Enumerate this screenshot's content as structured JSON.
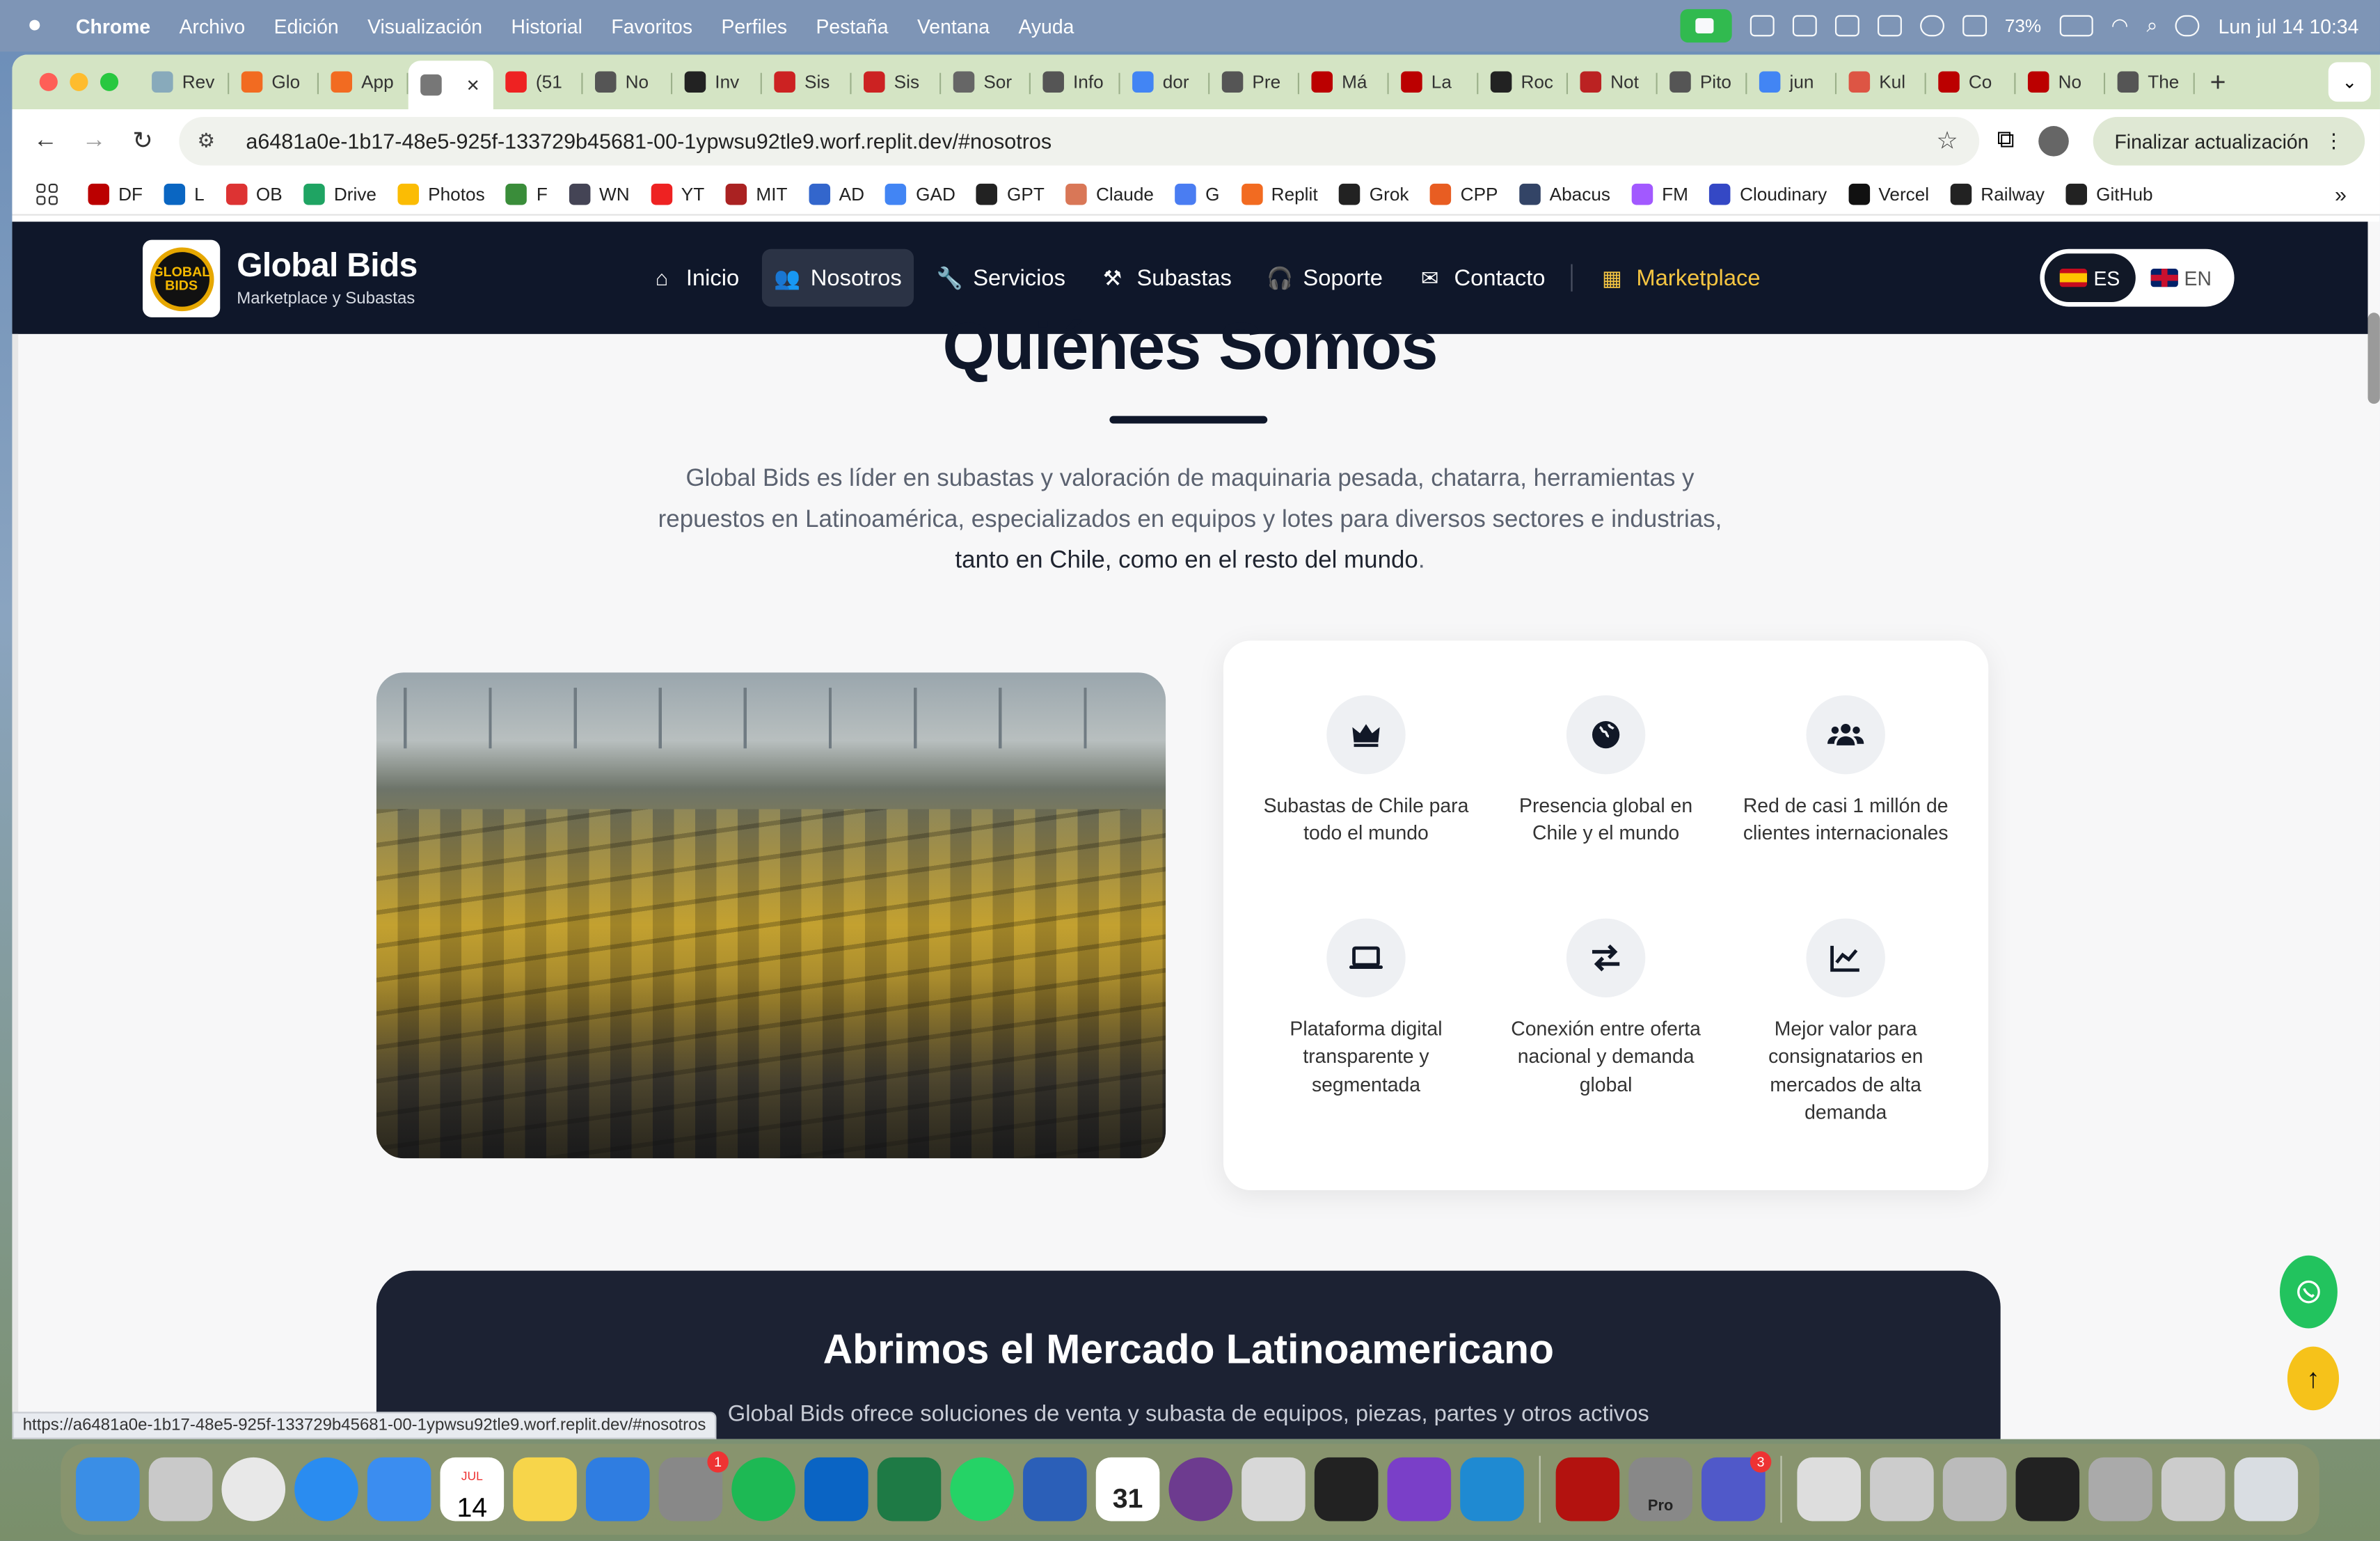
{
  "menubar": {
    "items": [
      "Chrome",
      "Archivo",
      "Edición",
      "Visualización",
      "Historial",
      "Favoritos",
      "Perfiles",
      "Pestaña",
      "Ventana",
      "Ayuda"
    ],
    "battery": "73%",
    "datetime": "Lun jul 14  10:34"
  },
  "browser": {
    "tabs": [
      {
        "label": "Rev",
        "color": "#8ab"
      },
      {
        "label": "Glo",
        "color": "#f26b21"
      },
      {
        "label": "App",
        "color": "#f26b21"
      },
      {
        "label": "",
        "color": "#777",
        "active": true
      },
      {
        "label": "(51",
        "color": "#e22"
      },
      {
        "label": "No",
        "color": "#555"
      },
      {
        "label": "Inv",
        "color": "#222"
      },
      {
        "label": "Sis",
        "color": "#c22"
      },
      {
        "label": "Sis",
        "color": "#c22"
      },
      {
        "label": "Sor",
        "color": "#666"
      },
      {
        "label": "Info",
        "color": "#555"
      },
      {
        "label": "dor",
        "color": "#4285f4"
      },
      {
        "label": "Pre",
        "color": "#555"
      },
      {
        "label": "Má",
        "color": "#b00"
      },
      {
        "label": "La",
        "color": "#b00"
      },
      {
        "label": "Roc",
        "color": "#222"
      },
      {
        "label": "Not",
        "color": "#b22"
      },
      {
        "label": "Pito",
        "color": "#555"
      },
      {
        "label": "jun",
        "color": "#4285f4"
      },
      {
        "label": "Kul",
        "color": "#d54"
      },
      {
        "label": "Co",
        "color": "#b00"
      },
      {
        "label": "No",
        "color": "#b00"
      },
      {
        "label": "The",
        "color": "#555"
      }
    ],
    "url": "a6481a0e-1b17-48e5-925f-133729b45681-00-1ypwsu92tle9.worf.replit.dev/#nosotros",
    "update_label": "Finalizar actualización",
    "bookmarks": [
      {
        "label": "DF",
        "color": "#b00"
      },
      {
        "label": "L",
        "color": "#0a66c2"
      },
      {
        "label": "OB",
        "color": "#d33"
      },
      {
        "label": "Drive",
        "color": "#1fa463"
      },
      {
        "label": "Photos",
        "color": "#fbbc04"
      },
      {
        "label": "F",
        "color": "#3a8d3a"
      },
      {
        "label": "WN",
        "color": "#445"
      },
      {
        "label": "YT",
        "color": "#e22"
      },
      {
        "label": "MIT",
        "color": "#a22"
      },
      {
        "label": "AD",
        "color": "#3366cc"
      },
      {
        "label": "GAD",
        "color": "#4285f4"
      },
      {
        "label": "GPT",
        "color": "#222"
      },
      {
        "label": "Claude",
        "color": "#d97757"
      },
      {
        "label": "G",
        "color": "#4a7df2"
      },
      {
        "label": "Replit",
        "color": "#f26b21"
      },
      {
        "label": "Grok",
        "color": "#222"
      },
      {
        "label": "CPP",
        "color": "#e85d22"
      },
      {
        "label": "Abacus",
        "color": "#346"
      },
      {
        "label": "FM",
        "color": "#a259ff"
      },
      {
        "label": "Cloudinary",
        "color": "#3448c5"
      },
      {
        "label": "Vercel",
        "color": "#111"
      },
      {
        "label": "Railway",
        "color": "#222"
      },
      {
        "label": "GitHub",
        "color": "#222"
      }
    ],
    "status_url": "https://a6481a0e-1b17-48e5-925f-133729b45681-00-1ypwsu92tle9.worf.replit.dev/#nosotros"
  },
  "site": {
    "brand_title": "Global Bids",
    "brand_subtitle": "Marketplace y Subastas",
    "logo_text": "GLOBAL BIDS",
    "nav": [
      {
        "label": "Inicio",
        "icon": "home-icon",
        "glyph": "⌂"
      },
      {
        "label": "Nosotros",
        "icon": "users-icon",
        "glyph": "👥",
        "active": true
      },
      {
        "label": "Servicios",
        "icon": "wrench-icon",
        "glyph": "🔧"
      },
      {
        "label": "Subastas",
        "icon": "gavel-icon",
        "glyph": "⚒"
      },
      {
        "label": "Soporte",
        "icon": "headset-icon",
        "glyph": "🎧"
      },
      {
        "label": "Contacto",
        "icon": "envelope-icon",
        "glyph": "✉"
      },
      {
        "label": "Marketplace",
        "icon": "grid-icon",
        "glyph": "▦",
        "accent": true
      }
    ],
    "lang": {
      "es": "ES",
      "en": "EN"
    },
    "colors": {
      "navy": "#0f172a",
      "accent": "#f5c542",
      "whatsapp": "#22c35e",
      "scrolltop": "#f6c21a"
    }
  },
  "about": {
    "title": "Quiénes Somos",
    "intro_plain": "Global Bids es líder en subastas y valoración de maquinaria pesada, chatarra, herramientas y repuestos en Latinoamérica, especializados en equipos y lotes para diversos sectores e industrias, ",
    "intro_emph": "tanto en Chile, como en el resto del mundo",
    "intro_end": ".",
    "features": [
      {
        "label": "Subastas de Chile para todo el mundo",
        "icon": "crown-icon"
      },
      {
        "label": "Presencia global en Chile y el mundo",
        "icon": "globe-icon"
      },
      {
        "label": "Red de casi 1 millón de clientes internacionales",
        "icon": "users-icon"
      },
      {
        "label": "Plataforma digital transparente y segmentada",
        "icon": "laptop-icon"
      },
      {
        "label": "Conexión entre oferta nacional y demanda global",
        "icon": "exchange-icon"
      },
      {
        "label": "Mejor valor para consignatarios en mercados de alta demanda",
        "icon": "chart-line-icon"
      }
    ]
  },
  "market": {
    "title": "Abrimos el Mercado Latinoamericano",
    "text": "Global Bids ofrece soluciones de venta y subasta de equipos, piezas, partes y otros activos"
  },
  "dock": {
    "apps": [
      {
        "name": "finder",
        "color": "#3a8ee6"
      },
      {
        "name": "launchpad",
        "color": "#c9c9c9"
      },
      {
        "name": "chrome",
        "color": "#e8e8e8"
      },
      {
        "name": "safari",
        "color": "#2a8cf0"
      },
      {
        "name": "mail",
        "color": "#3b8df0"
      },
      {
        "name": "calendar",
        "color": "#ffffff",
        "text": "14",
        "sub": "JUL"
      },
      {
        "name": "notes",
        "color": "#f7d54a"
      },
      {
        "name": "keynote",
        "color": "#2f7de1"
      },
      {
        "name": "settings",
        "color": "#888",
        "badge": "1"
      },
      {
        "name": "spotify",
        "color": "#1db954"
      },
      {
        "name": "outlook",
        "color": "#0a64c4"
      },
      {
        "name": "excel",
        "color": "#1e7a45"
      },
      {
        "name": "whatsapp",
        "color": "#25d366"
      },
      {
        "name": "word",
        "color": "#2b5fb8"
      },
      {
        "name": "calendar-31",
        "color": "#ffffff",
        "text": "31"
      },
      {
        "name": "obs",
        "color": "#6d3b8f"
      },
      {
        "name": "iphone-mirroring",
        "color": "#d8d8d8"
      },
      {
        "name": "replit",
        "color": "#222"
      },
      {
        "name": "github-desktop",
        "color": "#7a3fc8"
      },
      {
        "name": "vscode",
        "color": "#1f8ad2"
      },
      {
        "name": "acrobat",
        "color": "#b3120f"
      },
      {
        "name": "pro",
        "color": "#888",
        "text": "Pro"
      },
      {
        "name": "teams",
        "color": "#5059c9",
        "badge": "3"
      },
      {
        "name": "preview-doc",
        "color": "#ddd"
      },
      {
        "name": "window-1",
        "color": "#ccc"
      },
      {
        "name": "window-2",
        "color": "#bbb"
      },
      {
        "name": "terminal",
        "color": "#222"
      },
      {
        "name": "window-3",
        "color": "#aaa"
      },
      {
        "name": "window-4",
        "color": "#ccc"
      },
      {
        "name": "trash",
        "color": "#d9dde2"
      }
    ]
  }
}
